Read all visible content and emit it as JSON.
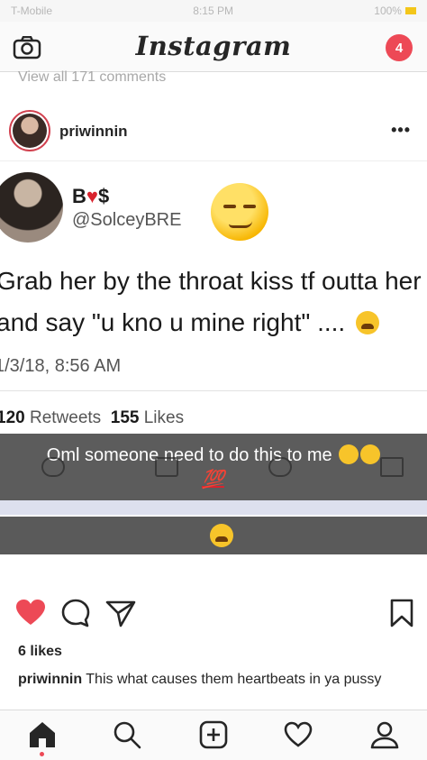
{
  "status_bar": {
    "carrier": "T-Mobile",
    "time": "8:15 PM",
    "battery": "100%"
  },
  "top_nav": {
    "brand": "Instagram",
    "notification_count": "4"
  },
  "feed": {
    "view_comments": "View all 171 comments"
  },
  "post": {
    "username": "priwinnin",
    "more_label": "•••",
    "image": {
      "tweet_name_prefix": "B",
      "tweet_name_heart": "♥",
      "tweet_name_suffix": "$",
      "tweet_handle": "@SolceyBRE",
      "tweet_line1": "Grab her by the throat kiss tf outta her",
      "tweet_line2": "and say \"u kno u mine right\" ....",
      "tweet_date": "1/3/18, 8:56 AM",
      "retweets_count": "120",
      "retweets_label": "Retweets",
      "likes_count": "155",
      "likes_label": "Likes",
      "overlay_caption": "Oml someone need to do this to me",
      "hundred_emoji": "💯"
    },
    "likes": "6 likes",
    "caption_user": "priwinnin",
    "caption_text": "This what causes them heartbeats in ya pussy"
  },
  "colors": {
    "like_red": "#ed4956",
    "tweet_heart": "#d9232e"
  }
}
